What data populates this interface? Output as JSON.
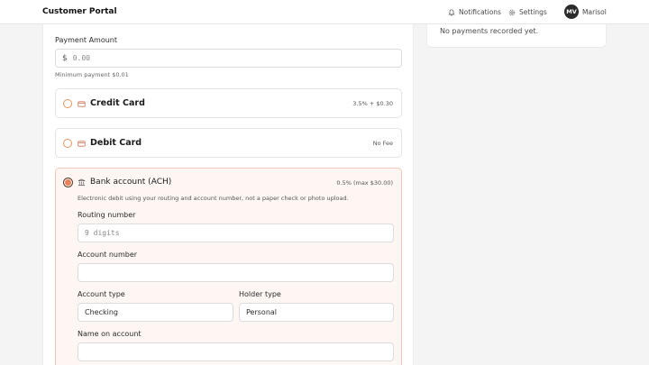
{
  "header": {
    "title": "Customer Portal",
    "notifications_label": "Notifications",
    "settings_label": "Settings",
    "avatar_initials": "MV",
    "user_name": "Marisol"
  },
  "sidebar": {
    "empty_text": "No payments recorded yet."
  },
  "payment": {
    "amount_label": "Payment Amount",
    "currency_symbol": "$",
    "amount_placeholder": "0.00",
    "min_hint": "Minimum payment $0.01"
  },
  "methods": [
    {
      "title": "Credit Card",
      "fee": "3.5% + $0.30",
      "selected": false,
      "icon": "credit-card-icon"
    },
    {
      "title": "Debit Card",
      "fee": "No Fee",
      "selected": false,
      "icon": "debit-card-icon"
    },
    {
      "title": "Bank account (ACH)",
      "fee": "0.5% (max $30.00)",
      "selected": true,
      "icon": "bank-icon",
      "description": "Electronic debit using your routing and account number, not a paper check or photo upload."
    }
  ],
  "ach": {
    "routing_label": "Routing number",
    "routing_placeholder": "9 digits",
    "account_label": "Account number",
    "account_value": "",
    "account_type_label": "Account type",
    "account_type_value": "Checking",
    "holder_type_label": "Holder type",
    "holder_type_value": "Personal",
    "name_label": "Name on account",
    "name_value": ""
  },
  "colors": {
    "accent": "#e8805a",
    "selected_bg": "#fdf6f3",
    "selected_border": "#f0c9b6"
  }
}
